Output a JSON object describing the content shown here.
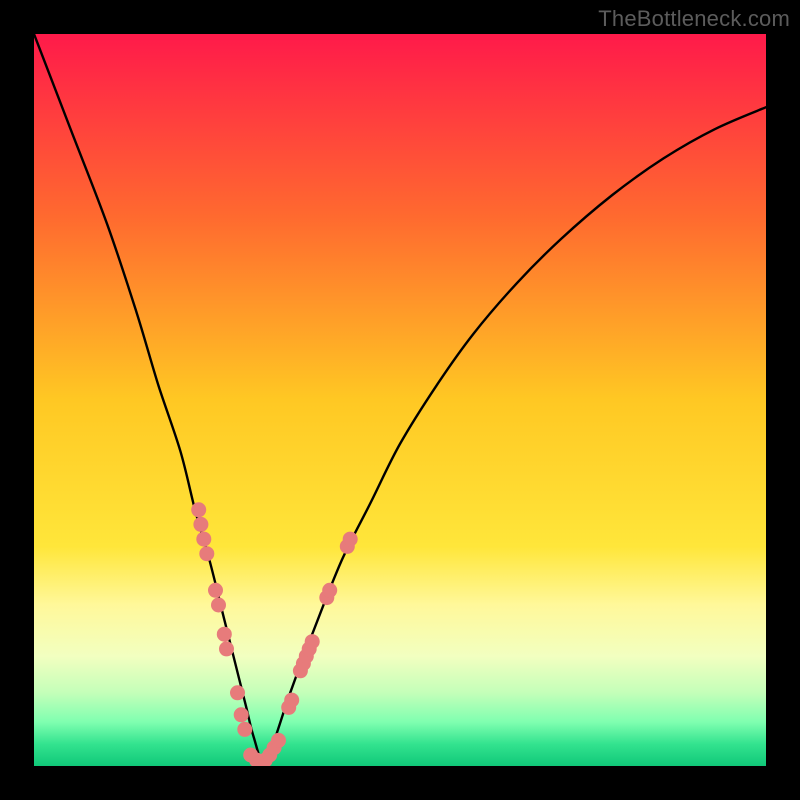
{
  "watermark_text": "TheBottleneck.com",
  "chart_data": {
    "type": "line",
    "title": "",
    "xlabel": "",
    "ylabel": "",
    "xlim": [
      0,
      100
    ],
    "ylim": [
      0,
      100
    ],
    "grid": false,
    "legend": false,
    "series": [
      {
        "name": "bottleneck-curve",
        "x": [
          0,
          5,
          10,
          14,
          17,
          20,
          22,
          24,
          26,
          27.5,
          29,
          30,
          31.5,
          33,
          35,
          38,
          42,
          46,
          50,
          55,
          60,
          66,
          72,
          79,
          86,
          93,
          100
        ],
        "y": [
          100,
          87,
          74,
          62,
          52,
          43,
          35,
          28,
          20,
          14,
          8,
          4,
          0,
          4,
          10,
          18,
          28,
          36,
          44,
          52,
          59,
          66,
          72,
          78,
          83,
          87,
          90
        ]
      }
    ],
    "points": {
      "name": "measurements",
      "color": "#e77b7b",
      "xy": [
        [
          22.5,
          35
        ],
        [
          22.8,
          33
        ],
        [
          23.2,
          31
        ],
        [
          23.6,
          29
        ],
        [
          24.8,
          24
        ],
        [
          25.2,
          22
        ],
        [
          26.0,
          18
        ],
        [
          26.3,
          16
        ],
        [
          27.8,
          10
        ],
        [
          28.3,
          7
        ],
        [
          28.8,
          5
        ],
        [
          29.6,
          1.5
        ],
        [
          30.4,
          0.8
        ],
        [
          31.0,
          0.5
        ],
        [
          31.6,
          0.8
        ],
        [
          32.2,
          1.5
        ],
        [
          32.8,
          2.5
        ],
        [
          33.4,
          3.5
        ],
        [
          34.8,
          8
        ],
        [
          35.2,
          9
        ],
        [
          36.4,
          13
        ],
        [
          36.8,
          14
        ],
        [
          37.2,
          15
        ],
        [
          37.6,
          16
        ],
        [
          38.0,
          17
        ],
        [
          40.0,
          23
        ],
        [
          40.4,
          24
        ],
        [
          42.8,
          30
        ],
        [
          43.2,
          31
        ]
      ]
    },
    "background_gradient_stops": [
      {
        "offset": 0.0,
        "color": "#ff1a4a"
      },
      {
        "offset": 0.25,
        "color": "#ff6a2f"
      },
      {
        "offset": 0.5,
        "color": "#ffc823"
      },
      {
        "offset": 0.7,
        "color": "#ffe63a"
      },
      {
        "offset": 0.78,
        "color": "#fff89a"
      },
      {
        "offset": 0.85,
        "color": "#f2ffc0"
      },
      {
        "offset": 0.9,
        "color": "#c4ffb9"
      },
      {
        "offset": 0.94,
        "color": "#7fffb0"
      },
      {
        "offset": 0.97,
        "color": "#33e38f"
      },
      {
        "offset": 1.0,
        "color": "#10c879"
      }
    ]
  }
}
